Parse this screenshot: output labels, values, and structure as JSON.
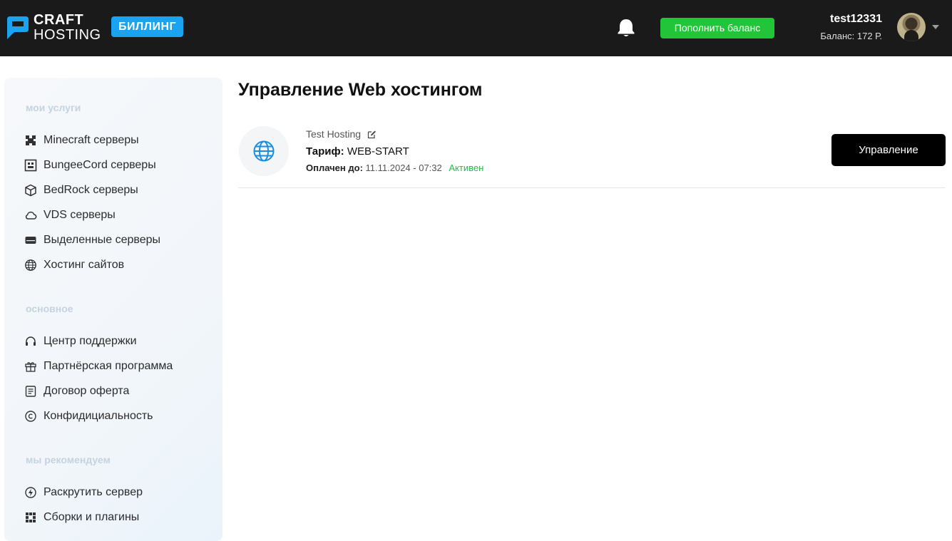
{
  "brand": {
    "line1": "CRAFT",
    "line2": "HOSTING",
    "badge": "БИЛЛИНГ",
    "accent": "#1aa3f0"
  },
  "header": {
    "notifications_icon": "bell-icon",
    "topup_label": "Пополнить баланс",
    "topup_color": "#22c53a",
    "user_name": "test12331",
    "balance": "Баланс: 172 Р."
  },
  "sidebar": {
    "sections": [
      {
        "title": "мои услуги",
        "items": [
          {
            "label": "Minecraft серверы",
            "icon": "minecraft-icon"
          },
          {
            "label": "BungeeCord серверы",
            "icon": "bungeecord-icon"
          },
          {
            "label": "BedRock серверы",
            "icon": "bedrock-icon"
          },
          {
            "label": "VDS серверы",
            "icon": "cloud-icon"
          },
          {
            "label": "Выделенные серверы",
            "icon": "server-icon"
          },
          {
            "label": "Хостинг сайтов",
            "icon": "globe-icon"
          }
        ]
      },
      {
        "title": "основное",
        "items": [
          {
            "label": "Центр поддержки",
            "icon": "headset-icon"
          },
          {
            "label": "Партнёрская программа",
            "icon": "gift-icon"
          },
          {
            "label": "Договор оферта",
            "icon": "document-icon"
          },
          {
            "label": "Конфидициальность",
            "icon": "copyright-icon"
          }
        ]
      },
      {
        "title": "мы рекомендуем",
        "items": [
          {
            "label": "Раскрутить сервер",
            "icon": "boost-icon"
          },
          {
            "label": "Сборки и плагины",
            "icon": "plugins-icon"
          }
        ]
      }
    ]
  },
  "main": {
    "title": "Управление Web хостингом",
    "service": {
      "name": "Test Hosting",
      "tariff_label": "Тариф:",
      "tariff_value": "WEB-START",
      "paid_label": "Оплачен до:",
      "paid_value": "11.11.2024 - 07:32",
      "status": "Активен",
      "status_color": "#2db84a",
      "manage_label": "Управление"
    }
  }
}
